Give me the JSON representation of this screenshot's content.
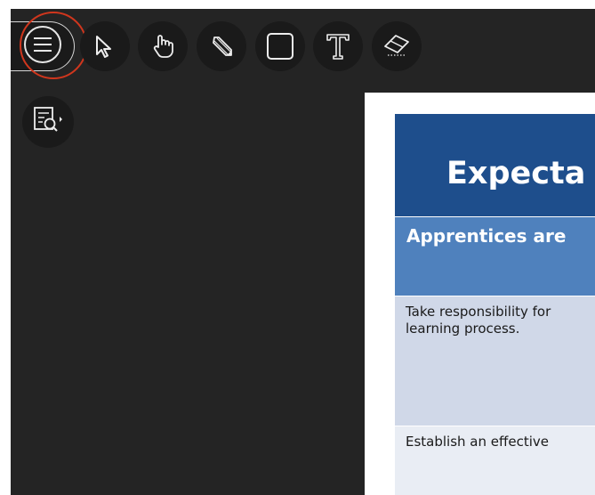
{
  "toolbar": {
    "icons": [
      "menu-icon",
      "pointer-arrow-icon",
      "hand-pan-icon",
      "pencil-icon",
      "rectangle-icon",
      "text-tool-icon",
      "eraser-icon"
    ],
    "secondary_icons": [
      "zoom-document-icon"
    ],
    "highlight_color": "#d0361d"
  },
  "document": {
    "title": "Expecta",
    "header": "Apprentices are",
    "rows": [
      {
        "line1": "Take responsibility for",
        "line2": "learning process."
      },
      {
        "line1": "Establish an effective"
      }
    ],
    "colors": {
      "title_bg": "#1e4e8c",
      "header_bg": "#4f81bd",
      "row1_bg": "#d0d8e8",
      "row2_bg": "#e9edf4"
    }
  }
}
